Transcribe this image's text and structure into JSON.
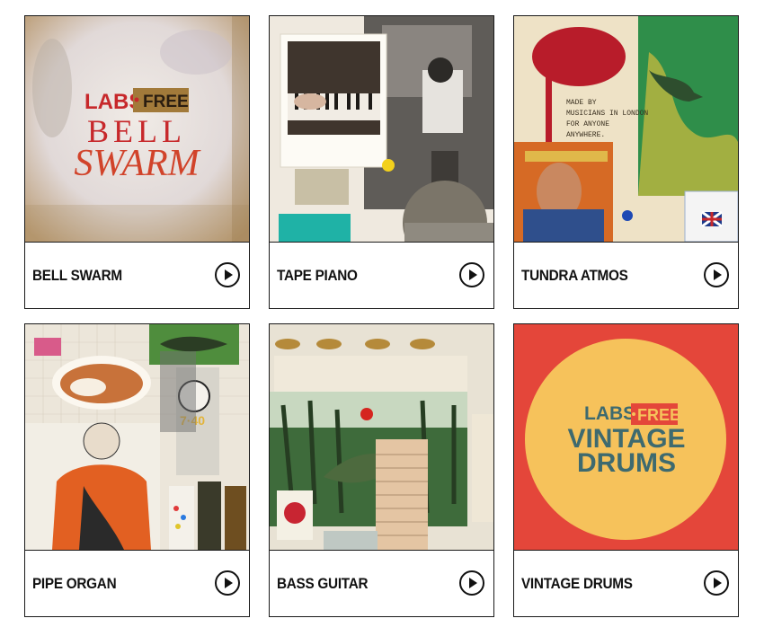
{
  "cards": [
    {
      "title": "BELL SWARM",
      "badge_labs": "LABS",
      "badge_free": "FREE",
      "art_line1": "BELL",
      "art_line2": "SWARM"
    },
    {
      "title": "TAPE PIANO"
    },
    {
      "title": "TUNDRA ATMOS",
      "art_text": [
        "MADE BY",
        "MUSICIANS IN LONDON",
        "FOR ANYONE",
        "ANYWHERE."
      ]
    },
    {
      "title": "PIPE ORGAN",
      "clock_text": "7·40"
    },
    {
      "title": "BASS GUITAR"
    },
    {
      "title": "VINTAGE DRUMS",
      "badge_labs": "LABS",
      "badge_free": "FREE",
      "art_line1": "VINTAGE",
      "art_line2": "DRUMS"
    }
  ],
  "play_icon": "play-icon",
  "colors": {
    "border": "#1a1a1a",
    "labs_red": "#c7282b",
    "free_bg": "#a27a3a",
    "drums_red": "#e4463a",
    "drums_yellow": "#f6c25b"
  }
}
